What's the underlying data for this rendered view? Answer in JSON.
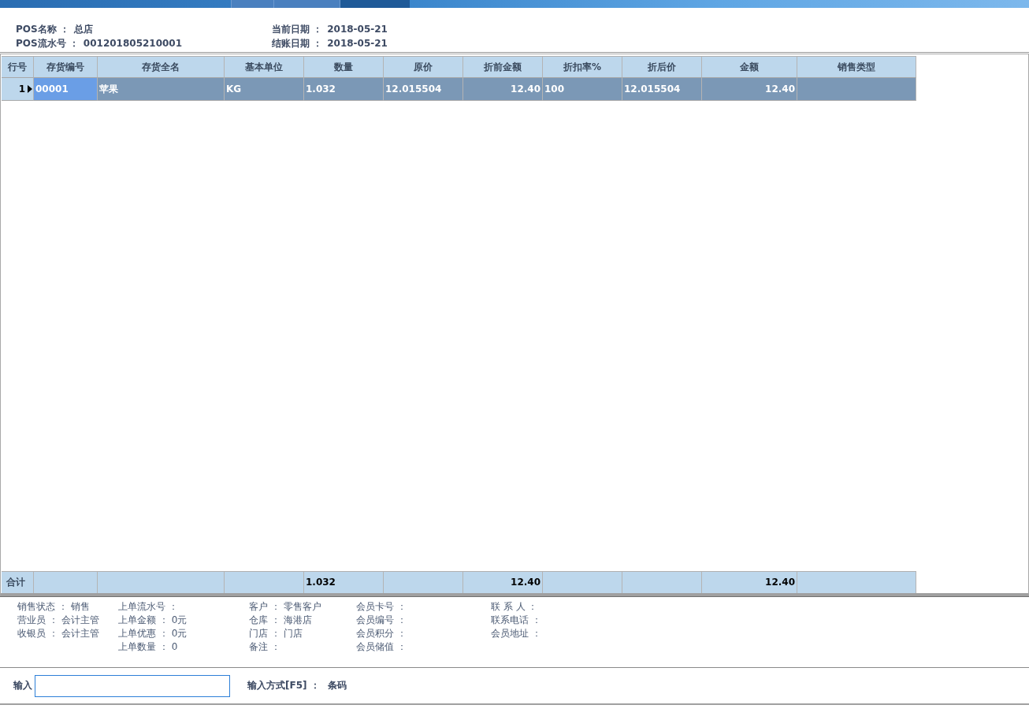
{
  "top_tabs": [
    {
      "selected": false
    },
    {
      "selected": false
    },
    {
      "selected": true
    }
  ],
  "header": {
    "columns": [
      {
        "fields": [
          {
            "label": "POS名称 ：",
            "value": "总店"
          },
          {
            "label": "POS流水号 ：",
            "value": "001201805210001"
          }
        ]
      },
      {
        "fields": [
          {
            "label": "当前日期 ：",
            "value": "2018-05-21"
          },
          {
            "label": "结账日期 ：",
            "value": "2018-05-21"
          }
        ]
      }
    ]
  },
  "table": {
    "columns": [
      {
        "label": "行号"
      },
      {
        "label": "存货编号"
      },
      {
        "label": "存货全名"
      },
      {
        "label": "基本单位"
      },
      {
        "label": "数量",
        "total": "1.032"
      },
      {
        "label": "原价"
      },
      {
        "label": "折前金额",
        "total": "12.40"
      },
      {
        "label": "折扣率%"
      },
      {
        "label": "折后价"
      },
      {
        "label": "金额",
        "total": "12.40"
      },
      {
        "label": "销售类型"
      }
    ],
    "rows": [
      {
        "selected": true,
        "cells": [
          {
            "text": "1",
            "selected": false
          },
          {
            "text": "00001",
            "selected": true
          },
          {
            "text": "苹果",
            "selected": false
          },
          {
            "text": "KG",
            "selected": false
          },
          {
            "text": "1.032",
            "selected": false
          },
          {
            "text": "12.015504",
            "selected": false
          },
          {
            "text": "12.40",
            "selected": false
          },
          {
            "text": "100",
            "selected": false
          },
          {
            "text": "12.015504",
            "selected": false
          },
          {
            "text": "12.40",
            "selected": false
          }
        ]
      }
    ],
    "totals_label": "合计"
  },
  "info": {
    "columns": [
      {
        "fields": [
          {
            "label": "销售状态 ：",
            "value": "销售"
          },
          {
            "label": "营业员 ：",
            "value": "会计主管"
          },
          {
            "label": "收银员 ：",
            "value": "会计主管"
          }
        ]
      },
      {
        "fields": [
          {
            "label": "上单流水号 ："
          },
          {
            "label": "上单金额 ：",
            "value": "0元"
          },
          {
            "label": "上单优惠 ：",
            "value": "0元"
          },
          {
            "label": "上单数量 ：",
            "value": "0"
          }
        ]
      },
      {
        "fields": [
          {
            "label": "客户 ：",
            "value": "零售客户"
          },
          {
            "label": "仓库 ：",
            "value": "海港店"
          },
          {
            "label": "门店 ：",
            "value": "门店"
          },
          {
            "label": "备注 ："
          }
        ]
      },
      {
        "fields": [
          {
            "label": "会员卡号 ："
          },
          {
            "label": "会员编号 ："
          },
          {
            "label": "会员积分 ："
          },
          {
            "label": "会员储值 ："
          }
        ]
      },
      {
        "fields": [
          {
            "label": "联 系 人 ："
          },
          {
            "label": "联系电话 ："
          },
          {
            "label": "会员地址 ："
          }
        ]
      }
    ]
  },
  "input": {
    "label": "输入",
    "focused": true,
    "mode_label": "输入方式[F5] ：",
    "mode_value": "条码"
  }
}
